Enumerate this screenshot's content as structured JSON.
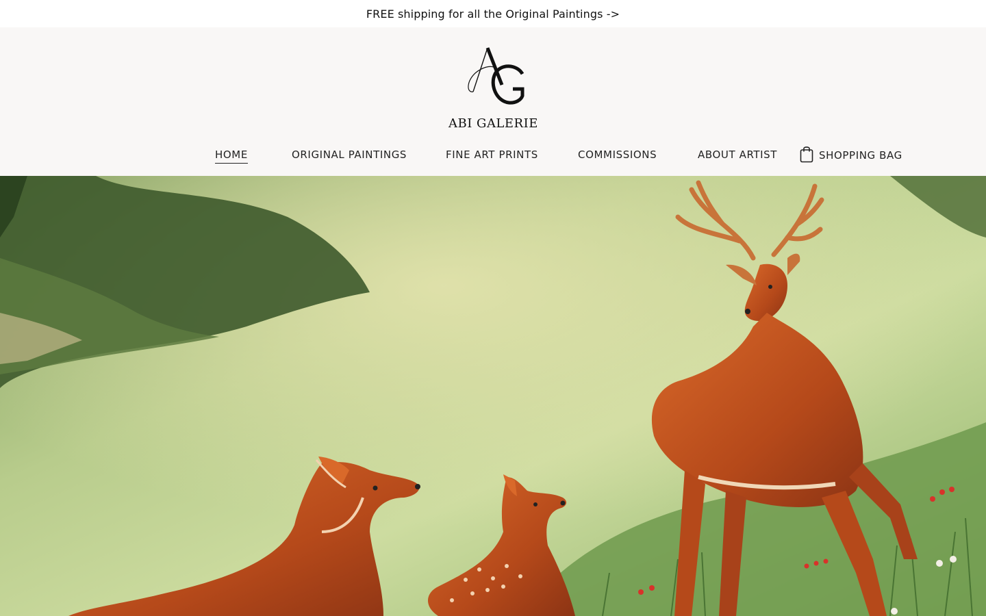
{
  "announcement": {
    "text": "FREE shipping for all the Original Paintings ->"
  },
  "brand": {
    "monogram": "AG",
    "name": "ABI GALERIE"
  },
  "nav": {
    "items": [
      {
        "label": "HOME",
        "active": true
      },
      {
        "label": "ORIGINAL PAINTINGS",
        "active": false
      },
      {
        "label": "FINE ART PRINTS",
        "active": false
      },
      {
        "label": "COMMISSIONS",
        "active": false
      },
      {
        "label": "ABOUT ARTIST",
        "active": false
      }
    ],
    "bag_label": "SHOPPING BAG",
    "bag_icon": "shopping-bag-icon"
  },
  "hero": {
    "image": "painting of a stag, doe and fawn in a green meadow"
  },
  "colors": {
    "header_bg": "#f9f7f6",
    "text": "#222222",
    "hero_green": "#a9c58a",
    "deer_orange": "#c5531c"
  }
}
